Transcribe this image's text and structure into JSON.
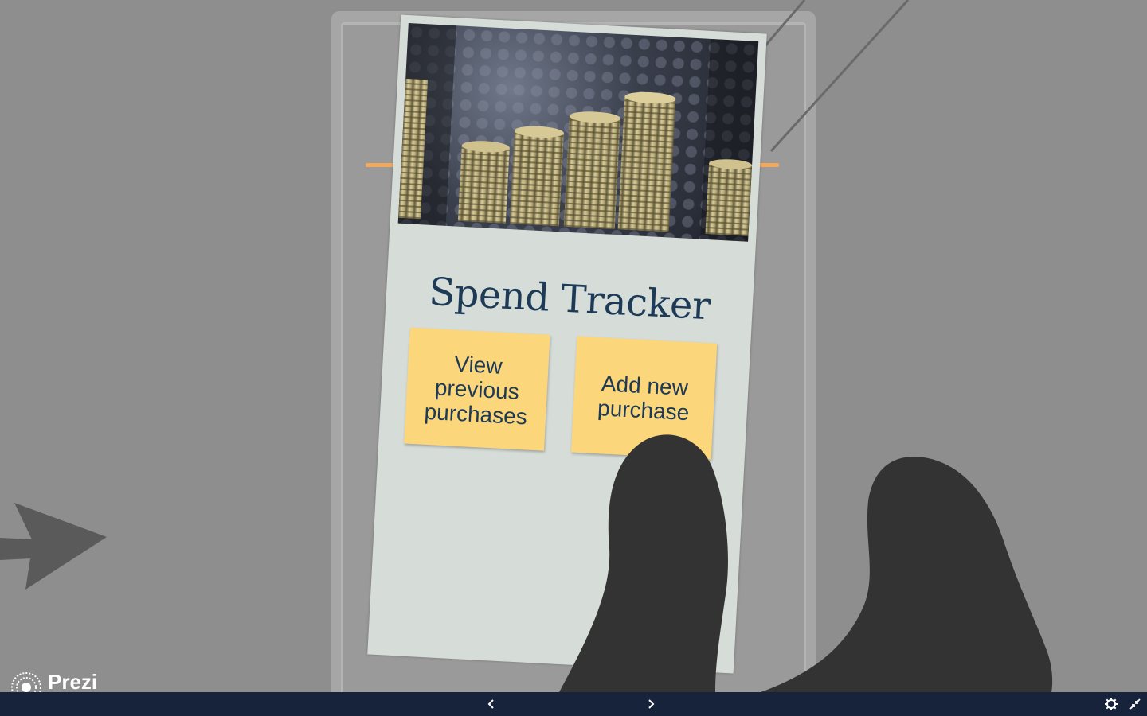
{
  "presentation": {
    "slide": {
      "title": "Spend Tracker",
      "buttons": [
        {
          "label": "View previous purchases"
        },
        {
          "label": "Add new purchase"
        }
      ],
      "photo_icon": "coin-stacks-image"
    },
    "brand": {
      "logo_text": "Prezi"
    }
  },
  "toolbar": {
    "prev_icon": "chevron-left-icon",
    "next_icon": "chevron-right-icon",
    "settings_icon": "gear-icon",
    "fullscreen_icon": "exit-fullscreen-icon"
  },
  "colors": {
    "background": "#8e8e8e",
    "card": "#d6dcd7",
    "title": "#1d3b57",
    "button": "#fcd67a",
    "accent_line": "#f3a85b",
    "hand": "#333333",
    "toolbar": "#16233a"
  }
}
